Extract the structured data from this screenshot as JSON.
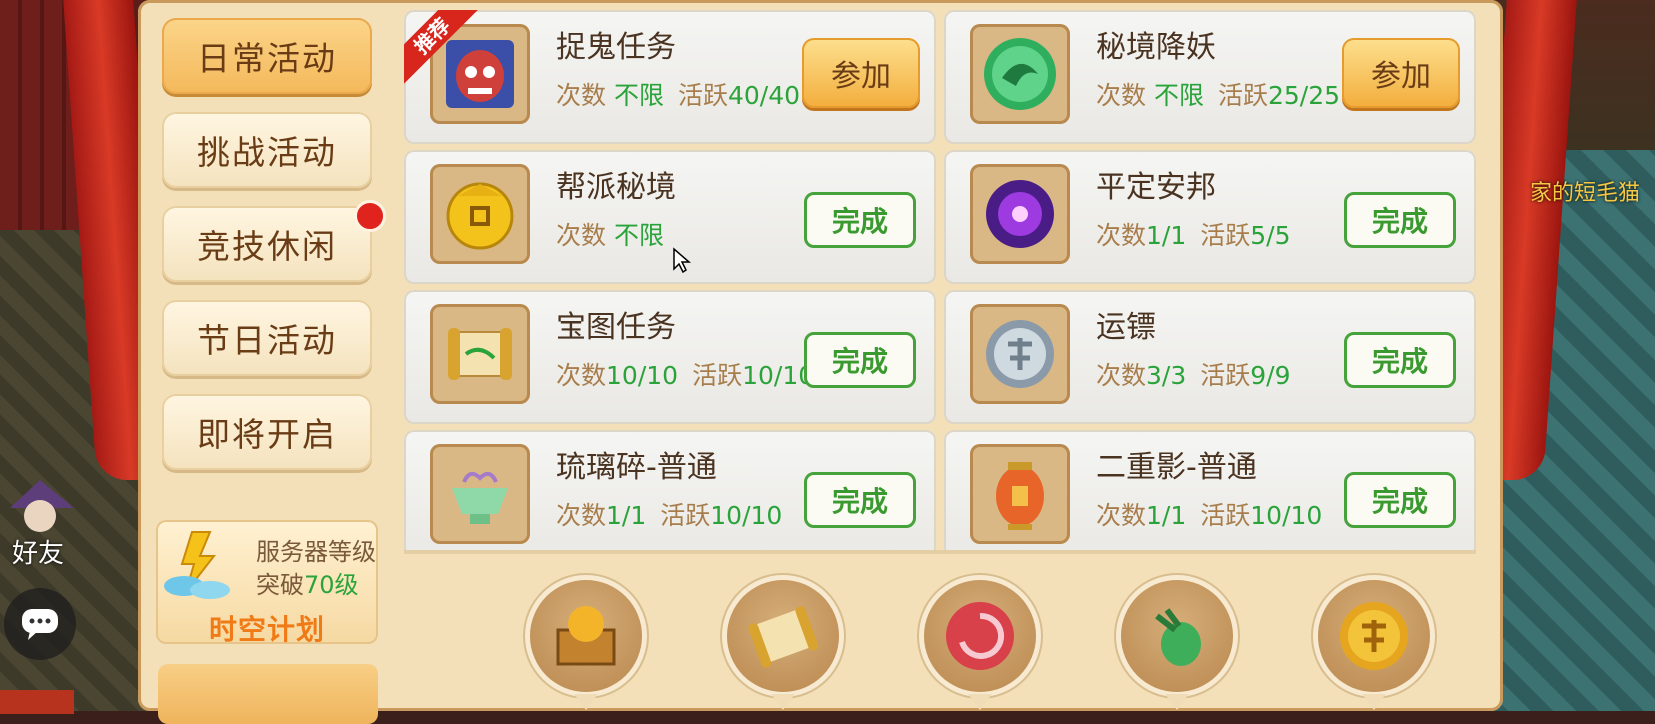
{
  "sidebar": {
    "tabs": [
      {
        "label": "日常活动",
        "active": true
      },
      {
        "label": "挑战活动",
        "active": false
      },
      {
        "label": "竞技休闲",
        "active": false,
        "has_notification": true
      },
      {
        "label": "节日活动",
        "active": false
      },
      {
        "label": "即将开启",
        "active": false
      }
    ],
    "promo": {
      "line1": "服务器等级",
      "line2_prefix": "突破",
      "line2_value": "70级",
      "title": "时空计划"
    }
  },
  "hud": {
    "friend_label": "好友",
    "enemy_text": "家的短毛猫"
  },
  "activities": [
    {
      "name": "捉鬼任务",
      "count_label": "次数",
      "count_value": "不限",
      "active_label": "活跃",
      "active_value": "40/40",
      "button": "参加",
      "recommended": true,
      "ribbon": "推荐",
      "icon": "mask-icon"
    },
    {
      "name": "秘境降妖",
      "count_label": "次数",
      "count_value": "不限",
      "active_label": "活跃",
      "active_value": "25/25",
      "button": "参加",
      "icon": "jade-dragon-icon"
    },
    {
      "name": "帮派秘境",
      "count_label": "次数",
      "count_value": "不限",
      "active_label": "",
      "active_value": "",
      "button": "完成",
      "icon": "gold-coin-icon"
    },
    {
      "name": "平定安邦",
      "count_label": "次数",
      "count_value": "1/1",
      "active_label": "活跃",
      "active_value": "5/5",
      "button": "完成",
      "icon": "purple-orb-icon"
    },
    {
      "name": "宝图任务",
      "count_label": "次数",
      "count_value": "10/10",
      "active_label": "活跃",
      "active_value": "10/10",
      "button": "完成",
      "icon": "treasure-map-icon"
    },
    {
      "name": "运镖",
      "count_label": "次数",
      "count_value": "3/3",
      "active_label": "活跃",
      "active_value": "9/9",
      "button": "完成",
      "icon": "silver-medal-icon"
    },
    {
      "name": "琉璃碎-普通",
      "count_label": "次数",
      "count_value": "1/1",
      "active_label": "活跃",
      "active_value": "10/10",
      "button": "完成",
      "icon": "glass-bowl-icon"
    },
    {
      "name": "二重影-普通",
      "count_label": "次数",
      "count_value": "1/1",
      "active_label": "活跃",
      "active_value": "10/10",
      "button": "完成",
      "icon": "lantern-icon"
    }
  ],
  "rewards": [
    {
      "icon": "treasure-chest-icon"
    },
    {
      "icon": "scroll-icon"
    },
    {
      "icon": "red-swirl-orb-icon"
    },
    {
      "icon": "green-pouch-icon"
    },
    {
      "icon": "gold-dream-coin-icon"
    }
  ],
  "colors": {
    "accent_green": "#2aa43a",
    "button_orange": "#f3ad3c",
    "panel_bg": "#f3dfb8",
    "notification_red": "#e0231c"
  }
}
